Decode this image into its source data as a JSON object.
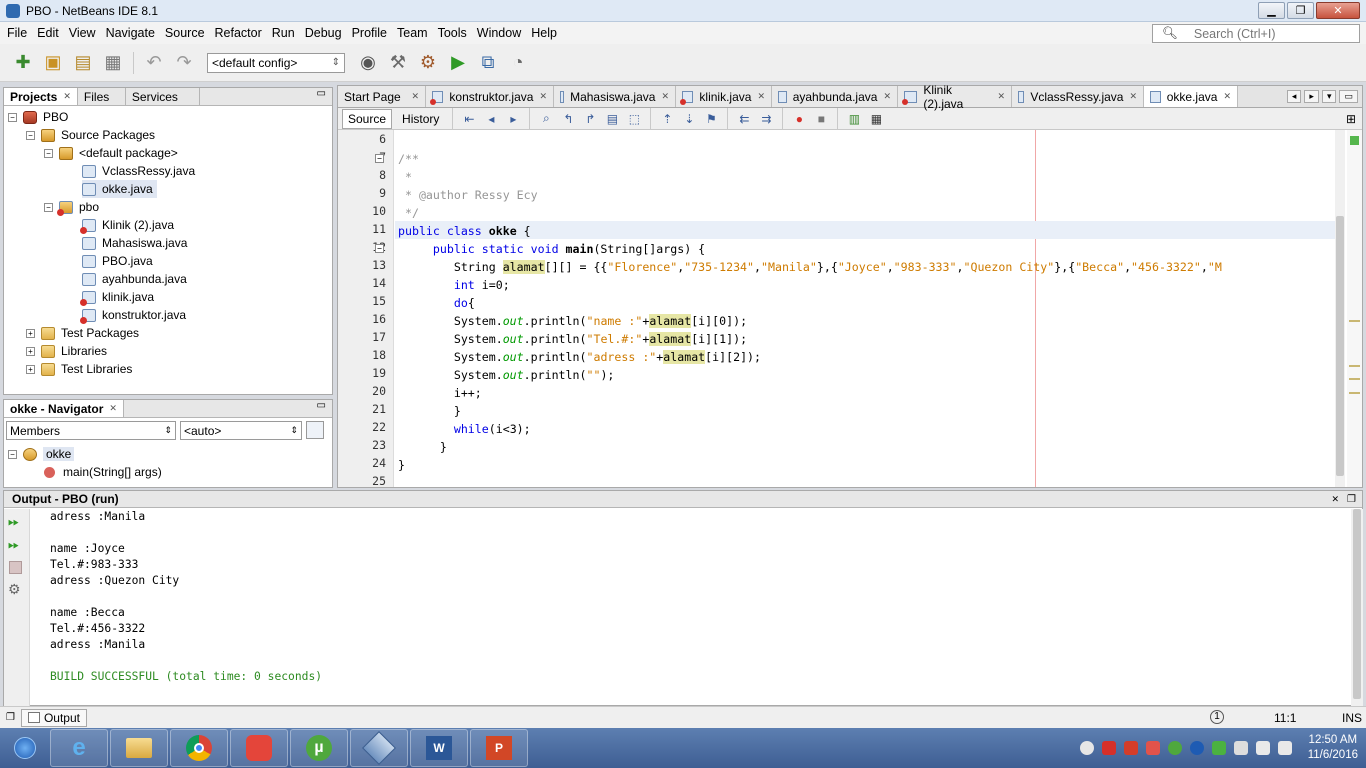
{
  "window": {
    "title": "PBO - NetBeans IDE 8.1",
    "controls": [
      "minimize",
      "maximize",
      "close"
    ]
  },
  "menu": [
    "File",
    "Edit",
    "View",
    "Navigate",
    "Source",
    "Refactor",
    "Run",
    "Debug",
    "Profile",
    "Team",
    "Tools",
    "Window",
    "Help"
  ],
  "search": {
    "placeholder": "Search (Ctrl+I)"
  },
  "toolbar": {
    "config": "<default config>"
  },
  "projects": {
    "tabs": [
      "Projects",
      "Files",
      "Services"
    ],
    "root": "PBO",
    "source_packages": "Source Packages",
    "default_package": "<default package>",
    "default_files": [
      "VclassRessy.java",
      "okke.java"
    ],
    "pbo_package": "pbo",
    "pbo_files": [
      "Klinik (2).java",
      "Mahasiswa.java",
      "PBO.java",
      "ayahbunda.java",
      "klinik.java",
      "konstruktor.java"
    ],
    "test_packages": "Test Packages",
    "libraries": "Libraries",
    "test_libraries": "Test Libraries"
  },
  "navigator": {
    "title": "okke - Navigator",
    "members": "Members",
    "auto": "<auto>",
    "class_name": "okke",
    "method": "main(String[] args)"
  },
  "editor": {
    "tabs": [
      "Start Page",
      "konstruktor.java",
      "Mahasiswa.java",
      "klinik.java",
      "ayahbunda.java",
      "Klinik (2).java",
      "VclassRessy.java",
      "okke.java"
    ],
    "views": {
      "source": "Source",
      "history": "History"
    },
    "line_numbers": [
      "6",
      "7",
      "8",
      "9",
      "10",
      "11",
      "12",
      "13",
      "14",
      "15",
      "16",
      "17",
      "18",
      "19",
      "20",
      "21",
      "22",
      "23",
      "24",
      "25"
    ]
  },
  "output": {
    "title": "Output - PBO (run)",
    "lines": [
      "adress :Manila",
      "",
      "name :Joyce",
      "Tel.#:983-333",
      "adress :Quezon City",
      "",
      "name :Becca",
      "Tel.#:456-3322",
      "adress :Manila",
      "",
      "BUILD SUCCESSFUL (total time: 0 seconds)"
    ]
  },
  "status": {
    "output_tab": "Output",
    "position": "11:1",
    "mode": "INS"
  },
  "taskbar": {
    "time": "12:50 AM",
    "date": "11/6/2016"
  }
}
